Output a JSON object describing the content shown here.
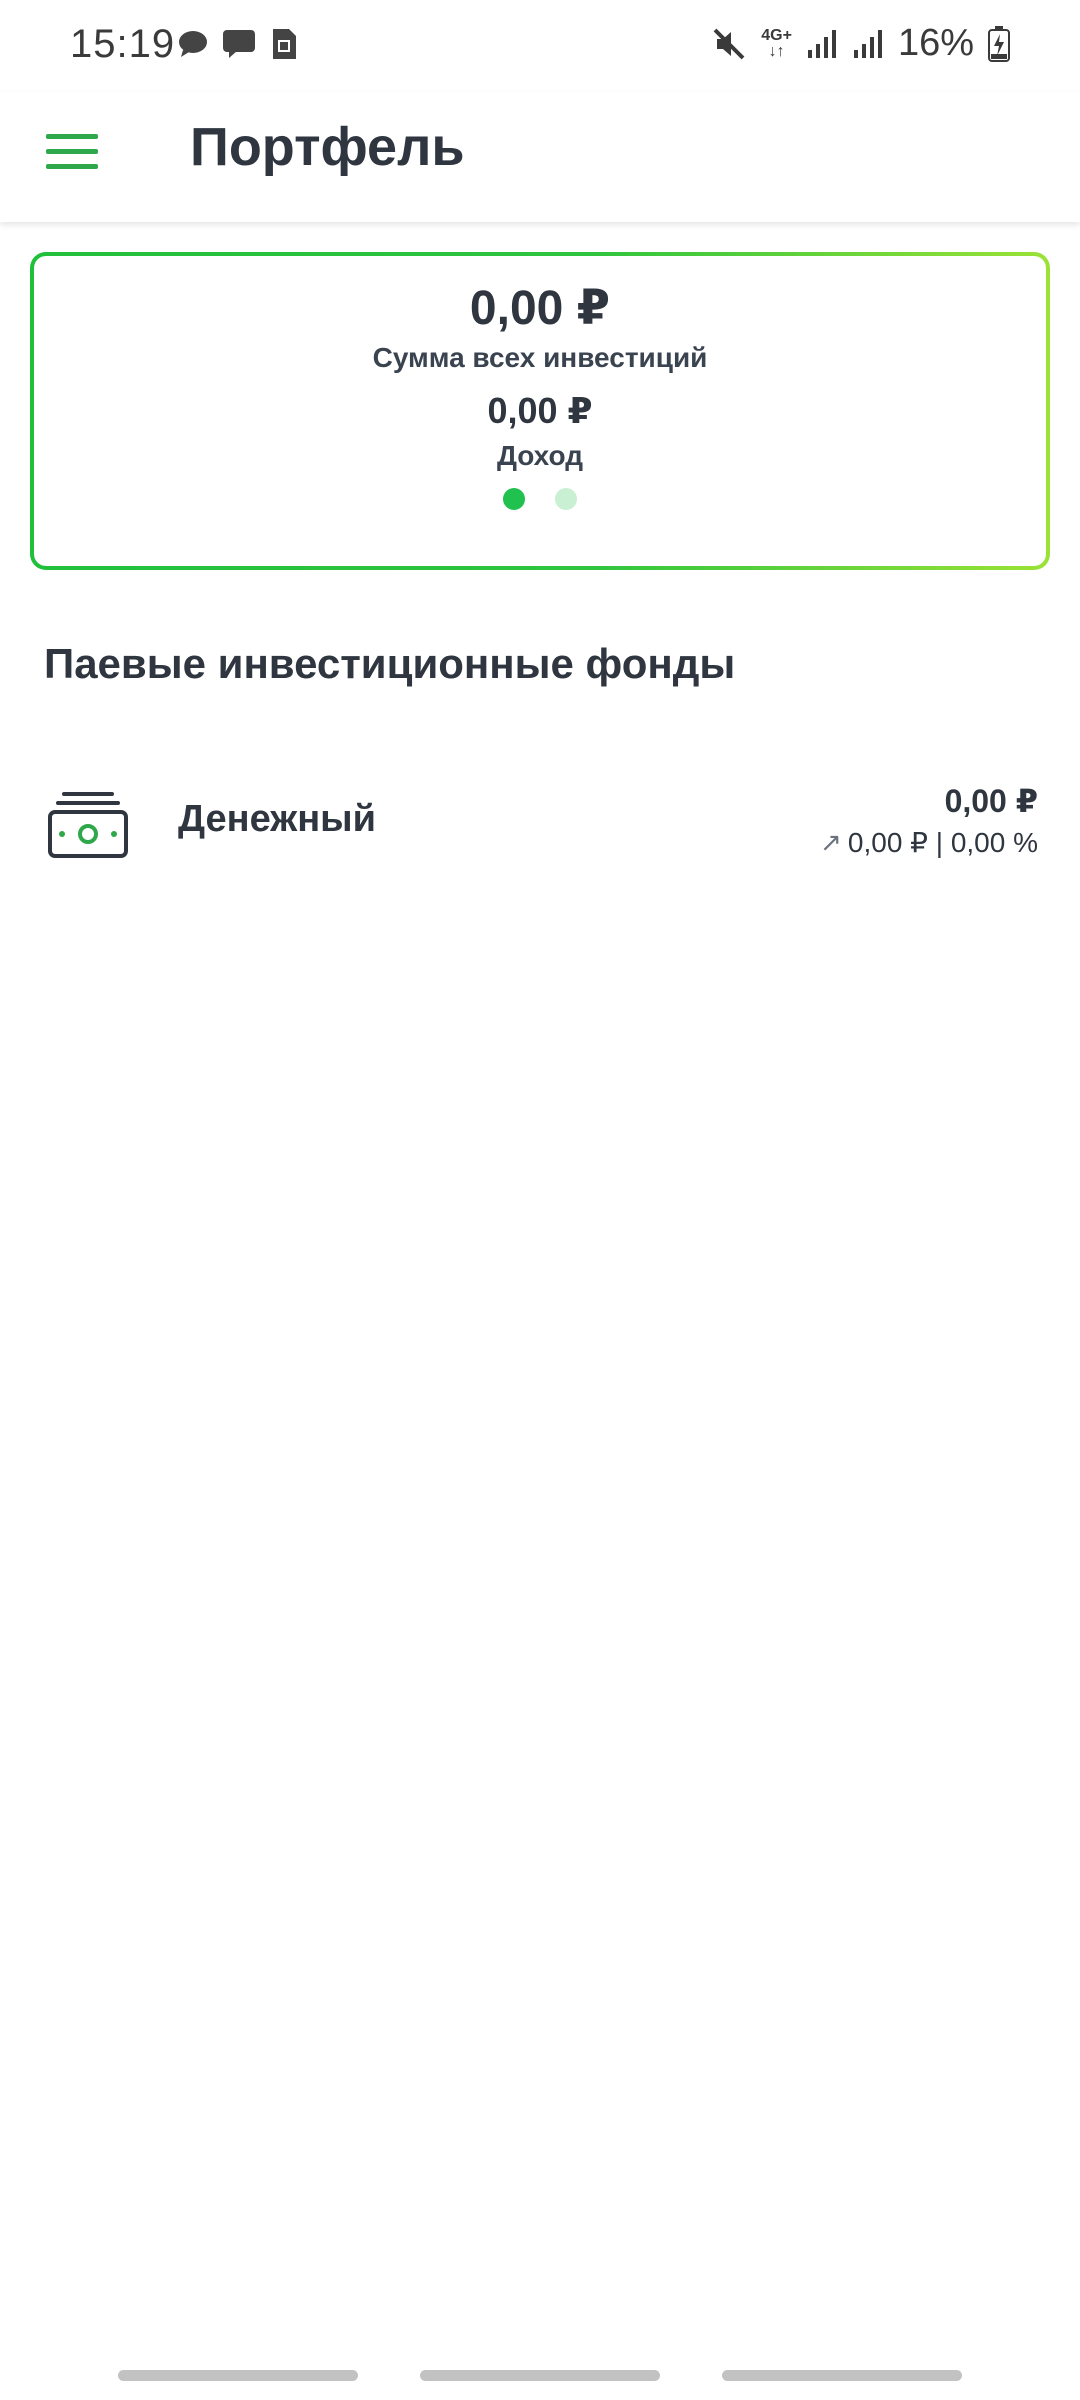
{
  "status_bar": {
    "time": "15:19",
    "network": "4G+",
    "battery": "16%"
  },
  "app_bar": {
    "title": "Портфель",
    "menu_icon": "hamburger-menu-icon"
  },
  "summary": {
    "total_value": "0,00 ₽",
    "total_label": "Сумма всех инвестиций",
    "income_value": "0,00 ₽",
    "income_label": "Доход",
    "pager": {
      "pages": 2,
      "active": 1
    }
  },
  "section": {
    "title": "Паевые инвестиционные фонды"
  },
  "funds": [
    {
      "name": "Денежный",
      "value": "0,00 ₽",
      "change": "0,00 ₽ | 0,00 %",
      "icon": "cash-icon"
    }
  ],
  "colors": {
    "accent": "#2ea84a",
    "card_gradient_start": "#21c03b",
    "card_gradient_end": "#9be236",
    "dot_active": "#21c150",
    "dot_inactive": "#c9f0d3",
    "text": "#2f3640"
  }
}
